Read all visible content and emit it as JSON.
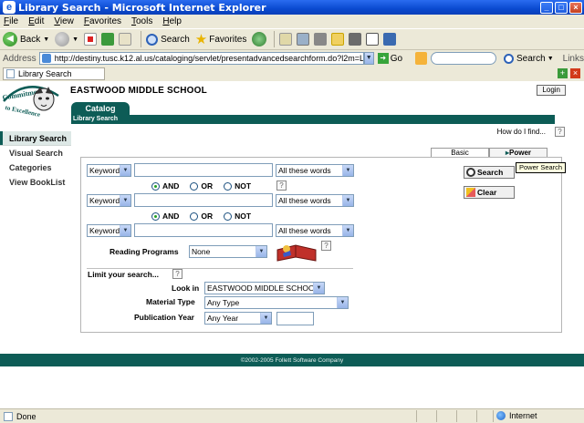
{
  "window": {
    "title": "Library Search - Microsoft Internet Explorer",
    "colors": {
      "titlebar": "#0a4ad0",
      "accent": "#0d5c56"
    }
  },
  "menu": [
    "File",
    "Edit",
    "View",
    "Favorites",
    "Tools",
    "Help"
  ],
  "toolbar": {
    "back_label": "Back",
    "search_label": "Search",
    "favorites_label": "Favorites"
  },
  "address": {
    "label": "Address",
    "url": "http://destiny.tusc.k12.al.us/cataloging/servlet/presentadvancedsearchform.do?l2m=Library%20Search",
    "go_label": "Go",
    "search_label": "Search",
    "links_label": "Links"
  },
  "ie_tab": {
    "title": "Library Search"
  },
  "page": {
    "school_name": "EASTWOOD MIDDLE SCHOOL",
    "login_label": "Login",
    "catalog_tab": "Catalog",
    "breadcrumb": "Library Search",
    "how_do_i": "How do I find...",
    "help_q": "?",
    "nav": [
      "Library Search",
      "Visual Search",
      "Categories",
      "View BookList"
    ],
    "tabs": {
      "basic": "Basic",
      "power": "Power"
    },
    "tooltip": "Power Search",
    "rows": [
      {
        "field": "Keyword",
        "value": "",
        "match": "All these words"
      },
      {
        "field": "Keyword",
        "value": "",
        "match": "All these words"
      },
      {
        "field": "Keyword",
        "value": "",
        "match": "All these words"
      }
    ],
    "operators": {
      "and": "AND",
      "or": "OR",
      "not": "NOT"
    },
    "buttons": {
      "search": "Search",
      "clear": "Clear"
    },
    "reading_programs": {
      "label": "Reading Programs",
      "value": "None"
    },
    "limit": {
      "label": "Limit your search...",
      "look_in_label": "Look in",
      "look_in_value": "EASTWOOD MIDDLE SCHOOL",
      "material_label": "Material Type",
      "material_value": "Any Type",
      "pubyear_label": "Publication Year",
      "pubyear_value": "Any Year",
      "pubyear_input": ""
    },
    "footer": "©2002-2005  Follett Software Company"
  },
  "status": {
    "text": "Done",
    "zone": "Internet"
  }
}
